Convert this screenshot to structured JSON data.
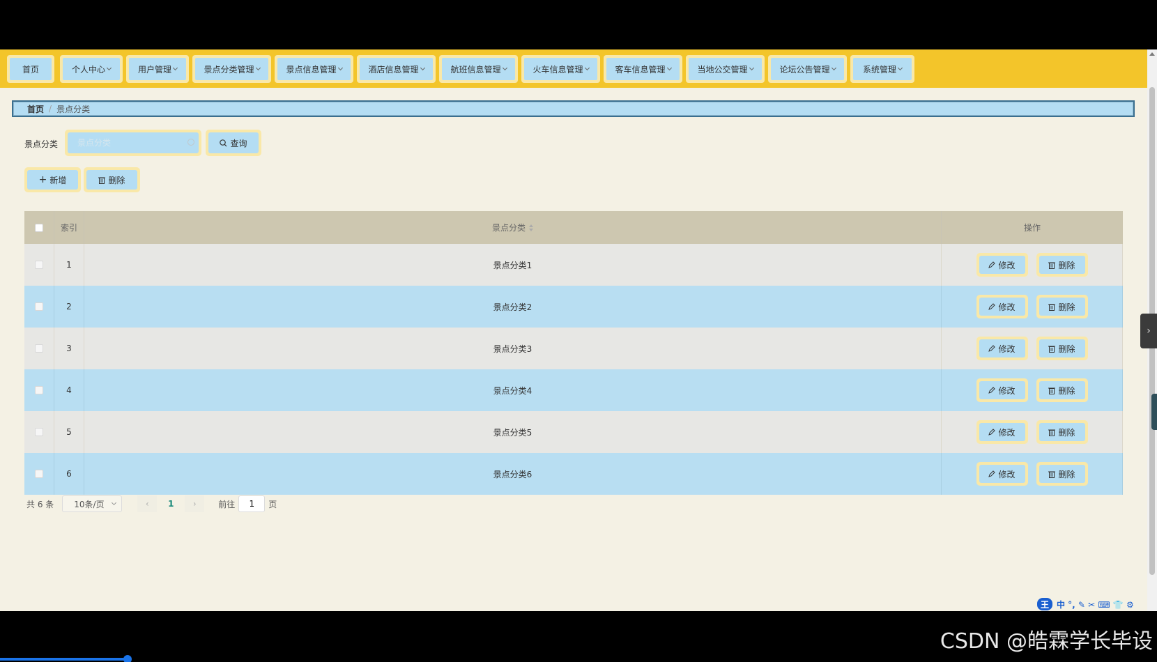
{
  "nav": {
    "items": [
      {
        "label": "首页",
        "has_dropdown": false
      },
      {
        "label": "个人中心",
        "has_dropdown": true
      },
      {
        "label": "用户管理",
        "has_dropdown": true
      },
      {
        "label": "景点分类管理",
        "has_dropdown": true
      },
      {
        "label": "景点信息管理",
        "has_dropdown": true
      },
      {
        "label": "酒店信息管理",
        "has_dropdown": true
      },
      {
        "label": "航班信息管理",
        "has_dropdown": true
      },
      {
        "label": "火车信息管理",
        "has_dropdown": true
      },
      {
        "label": "客车信息管理",
        "has_dropdown": true
      },
      {
        "label": "当地公交管理",
        "has_dropdown": true
      },
      {
        "label": "论坛公告管理",
        "has_dropdown": true
      },
      {
        "label": "系统管理",
        "has_dropdown": true
      }
    ]
  },
  "breadcrumb": {
    "home": "首页",
    "current": "景点分类"
  },
  "search": {
    "label": "景点分类",
    "placeholder": "景点分类",
    "value": "",
    "query_button": "查询"
  },
  "actions": {
    "add_button": "新增",
    "delete_button": "删除"
  },
  "table": {
    "headers": {
      "index": "索引",
      "name": "景点分类",
      "operations": "操作"
    },
    "rows": [
      {
        "index": "1",
        "name": "景点分类1"
      },
      {
        "index": "2",
        "name": "景点分类2"
      },
      {
        "index": "3",
        "name": "景点分类3"
      },
      {
        "index": "4",
        "name": "景点分类4"
      },
      {
        "index": "5",
        "name": "景点分类5"
      },
      {
        "index": "6",
        "name": "景点分类6"
      }
    ],
    "row_edit_label": "修改",
    "row_delete_label": "删除"
  },
  "pagination": {
    "total_text": "共 6 条",
    "page_size": "10条/页",
    "current_page": "1",
    "goto_label": "前往",
    "goto_value": "1",
    "page_suffix": "页"
  },
  "watermark": "CSDN @皓霖学长毕设",
  "ime": {
    "logo": "王",
    "mode": "中 °, ✎ ✂ ⌨ 👕 ⚙"
  },
  "colors": {
    "nav_bg": "#f3c52a",
    "button_bg": "#b4ddf3",
    "button_border": "#f9e8a8",
    "page_bg": "#f4f1e4",
    "header_bg": "#cdc7b0",
    "row_alt": "#b8def2",
    "pager_active": "#1a8a7a"
  }
}
